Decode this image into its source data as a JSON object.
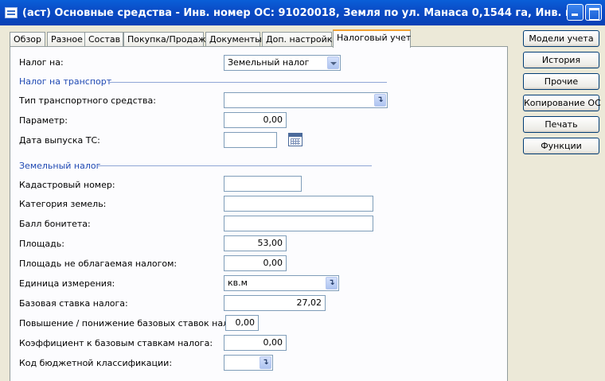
{
  "window": {
    "title": "(аст) Основные средства - Инв. номер ОС: 91020018, Земля по ул. Манаса  0,1544 га, Инв. номер ОС: ..."
  },
  "tabs": [
    "Обзор",
    "Разное",
    "Состав",
    "Покупка/Продажа",
    "Документы",
    "Доп. настройки",
    "Налоговый учет"
  ],
  "active_tab": "Налоговый учет",
  "form": {
    "tax_on": {
      "label": "Налог на:",
      "value": "Земельный налог"
    },
    "transport_section": "Налог на транспорт",
    "vehicle_type": {
      "label": "Тип транспортного средства:",
      "value": ""
    },
    "parameter": {
      "label": "Параметр:",
      "value": "0,00"
    },
    "vehicle_date": {
      "label": "Дата выпуска ТС:",
      "value": ""
    },
    "land_section": "Земельный налог",
    "cadastral": {
      "label": "Кадастровый номер:",
      "value": ""
    },
    "land_category": {
      "label": "Категория земель:",
      "value": ""
    },
    "fertility": {
      "label": "Балл бонитета:",
      "value": ""
    },
    "area": {
      "label": "Площадь:",
      "value": "53,00"
    },
    "untaxed_area": {
      "label": "Площадь не облагаемая налогом:",
      "value": "0,00"
    },
    "unit": {
      "label": "Единица измерения:",
      "value": "кв.м"
    },
    "base_rate": {
      "label": "Базовая ставка налога:",
      "value": "27,02"
    },
    "rate_adjust": {
      "label": "Повышение / понижение базовых ставок налога:",
      "value": "0,00"
    },
    "rate_coef": {
      "label": "Коэффициент к базовым ставкам налога:",
      "value": "0,00"
    },
    "budget_code": {
      "label": "Код бюджетной классификации:",
      "value": ""
    }
  },
  "side_buttons": [
    "Модели учета",
    "История",
    "Прочие",
    "Копирование ОС",
    "Печать",
    "Функции"
  ],
  "icons": {
    "app": "form-icon",
    "minimize": "minimize-icon",
    "maximize": "maximize-icon",
    "dropdown": "chevron-down-icon",
    "lookup": "lookup-arrow-icon",
    "calendar": "calendar-icon"
  },
  "colors": {
    "titlebar": "#0a4cc7",
    "section_text": "#1f49b3",
    "active_tab_accent": "#f0a030"
  }
}
